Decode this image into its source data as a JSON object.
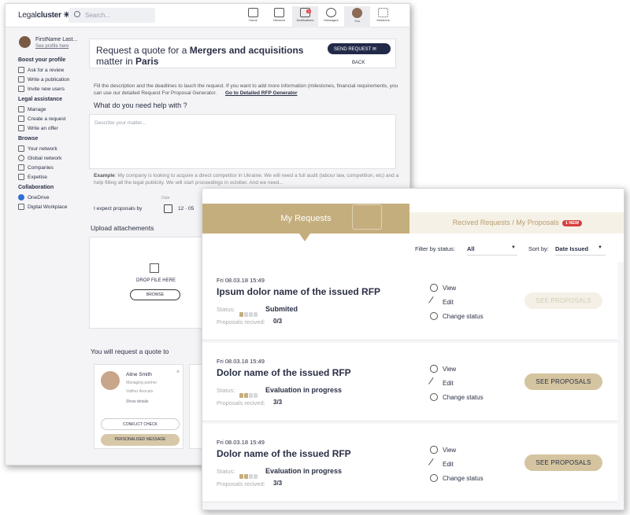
{
  "topbar": {
    "logo_main": "Legal",
    "logo_sub": "cluster",
    "search_placeholder": "Search...",
    "nav": [
      {
        "label": "Home",
        "icon": "home-icon"
      },
      {
        "label": "Network",
        "icon": "network-icon"
      },
      {
        "label": "Notifications",
        "icon": "bell-icon",
        "badge": "1"
      },
      {
        "label": "Messages",
        "icon": "chat-icon"
      },
      {
        "label": "You",
        "icon": "avatar"
      },
      {
        "label": "Solutions",
        "icon": "grid-icon"
      }
    ]
  },
  "sidebar": {
    "profile_name": "FirstName Last...",
    "profile_link": "See profile here",
    "sections": [
      {
        "title": "Boost your profile",
        "items": [
          "Ask for a review",
          "Write a publication",
          "Invite new users"
        ]
      },
      {
        "title": "Legal assistance",
        "items": [
          "Manage",
          "Create a request",
          "Write an offer"
        ]
      },
      {
        "title": "Browse",
        "items": [
          "Your network",
          "Global network",
          "Companies",
          "Expetise"
        ]
      },
      {
        "title": "Collaboration",
        "items": [
          "OneDrive",
          "Digital Workplace"
        ]
      }
    ]
  },
  "request": {
    "title_pre": "Request a quote for a ",
    "title_bold": "Mergers and acquisitions",
    "title_mid": " matter in ",
    "title_city": "Paris",
    "send_label": "SEND REQUEST",
    "back_label": "BACK",
    "intro": "Fill the description and the deadlines to lauch the request. If you want to add more information (milestones, financial requirements, you can use our detailed Request For Proposal Generator.",
    "intro_link": "Go to Detailed RFP Generator",
    "question": "What do you need help with ?",
    "textarea_placeholder": "Describe your matter...",
    "example_label": "Example",
    "example_text": ": My company is looking to acquire a direct competitor in Ukraine. We will need a full audit (labour law, competition, etc) and a help filling all the legal publicity. We will start proceedings in october. And we need...",
    "expect_label": "I expect proposals by",
    "date_label": "Date",
    "date_value": "12 · 05",
    "upload_title": "Upload attachements",
    "drop_label": "DROP FILE HERE",
    "browse_label": "BROWSE",
    "will_request_title": "You will request a quote to"
  },
  "lawyer": {
    "name": "Aline Smith",
    "role": "Managing partner",
    "firm": "Valther Avocats",
    "details": "Show details",
    "conflict": "CONFLICT CHECK",
    "personalised": "PERSONALISED MESSAGE"
  },
  "requests_panel": {
    "tab_active": "My Requests",
    "tab_other": "Recived Requests / My Proposals",
    "new_badge": "1 NEW",
    "filter_label": "Filter by status:",
    "filter_value": "All",
    "sort_label": "Sort by:",
    "sort_value": "Date Issued",
    "status_label": "Status:",
    "proposals_label": "Proposals recived:",
    "actions": {
      "view": "View",
      "edit": "Edit",
      "change": "Change status"
    },
    "see_label": "SEE PROPOSALS",
    "rows": [
      {
        "date": "Fri 08.03.18 15:49",
        "name": "Ipsum dolor name of the issued RFP",
        "status": "Submited",
        "proposals": "0/3"
      },
      {
        "date": "Fri 08.03.18 15:49",
        "name": "Dolor name of the issued RFP",
        "status": "Evaluation in progress",
        "proposals": "3/3"
      },
      {
        "date": "Fri 08.03.18 15:49",
        "name": "Dolor name of the issued RFP",
        "status": "Evaluation in progress",
        "proposals": "3/3"
      }
    ]
  }
}
